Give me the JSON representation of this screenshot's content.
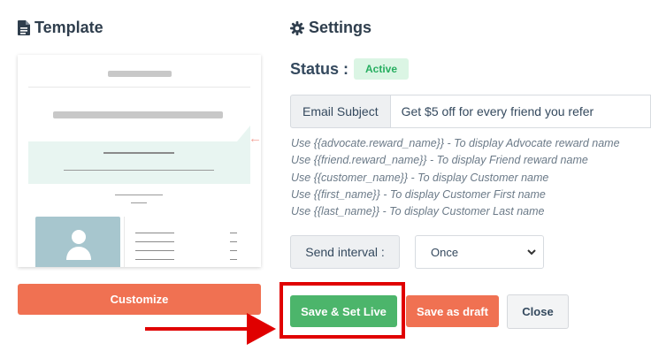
{
  "template": {
    "heading": "Template",
    "customize_label": "Customize"
  },
  "settings": {
    "heading": "Settings",
    "status_label": "Status :",
    "status_value": "Active",
    "email_subject_label": "Email Subject",
    "email_subject_value": "Get $5 off for every friend you refer",
    "hints": [
      "Use {{advocate.reward_name}} - To display Advocate reward name",
      "Use {{friend.reward_name}} - To display Friend reward name",
      "Use {{customer_name}} - To display Customer name",
      "Use {{first_name}} - To display Customer First name",
      "Use {{last_name}} - To display Customer Last name"
    ],
    "send_interval_label": "Send interval :",
    "send_interval_value": "Once"
  },
  "actions": {
    "save_live": "Save & Set Live",
    "save_draft": "Save as draft",
    "close": "Close"
  },
  "colors": {
    "primary_orange": "#f07152",
    "success_green": "#4cb56b",
    "highlight_red": "#e00000",
    "badge_bg": "#dbf5e4"
  },
  "icons": {
    "template": "file-icon",
    "settings": "gear-icon",
    "select": "chevron-down-icon",
    "avatar": "user-icon"
  }
}
